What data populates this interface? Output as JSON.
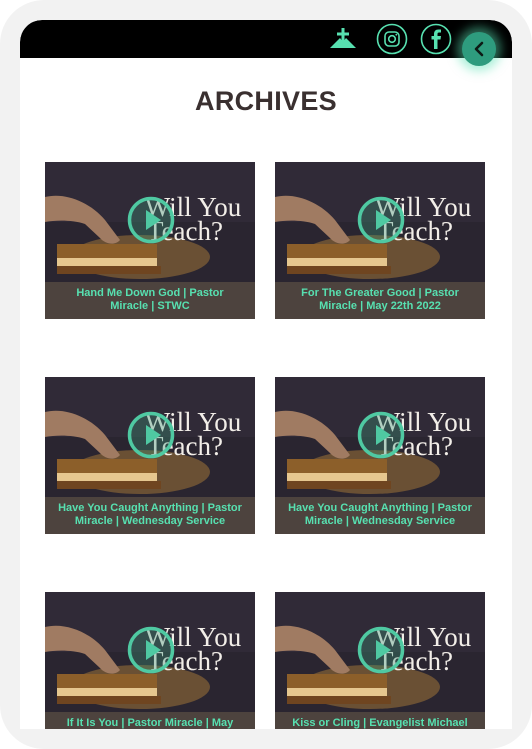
{
  "header": {
    "icons": [
      "church-logo-icon",
      "instagram-icon",
      "facebook-icon"
    ],
    "back_icon": "chevron-left-icon",
    "accent_color": "#57e0b0"
  },
  "page": {
    "title": "ARCHIVES"
  },
  "thumbnail": {
    "overlay_line1": "Will You",
    "overlay_line2": "Teach?"
  },
  "videos": [
    {
      "line1": "Hand Me Down God | Pastor",
      "line2": "Miracle | STWC"
    },
    {
      "line1": "For The Greater Good | Pastor",
      "line2": "Miracle | May 22th 2022"
    },
    {
      "line1": "Have You Caught Anything | Pastor",
      "line2": "Miracle | Wednesday Service"
    },
    {
      "line1": "Have You Caught Anything | Pastor",
      "line2": "Miracle | Wednesday Service"
    },
    {
      "line1": "If It Is You | Pastor Miracle | May",
      "line2": ""
    },
    {
      "line1": "Kiss or Cling | Evangelist Michael",
      "line2": ""
    }
  ]
}
